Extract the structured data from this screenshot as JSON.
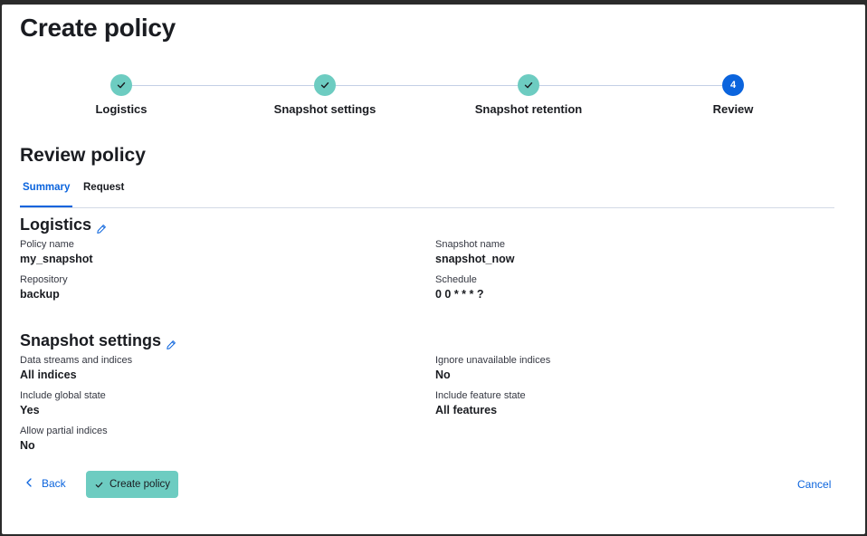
{
  "page": {
    "title": "Create policy"
  },
  "stepper": {
    "steps": [
      {
        "label": "Logistics",
        "status": "complete",
        "marker": ""
      },
      {
        "label": "Snapshot settings",
        "status": "complete",
        "marker": ""
      },
      {
        "label": "Snapshot retention",
        "status": "complete",
        "marker": ""
      },
      {
        "label": "Review",
        "status": "current",
        "marker": "4"
      }
    ]
  },
  "review": {
    "title": "Review policy",
    "tabs": [
      {
        "label": "Summary",
        "active": true
      },
      {
        "label": "Request",
        "active": false
      }
    ]
  },
  "logistics": {
    "title": "Logistics",
    "fields": {
      "policy_name": {
        "label": "Policy name",
        "value": "my_snapshot"
      },
      "snapshot_name": {
        "label": "Snapshot name",
        "value": "snapshot_now"
      },
      "repository": {
        "label": "Repository",
        "value": "backup"
      },
      "schedule": {
        "label": "Schedule",
        "value": "0 0 * * * ?"
      }
    }
  },
  "settings": {
    "title": "Snapshot settings",
    "fields": {
      "data_streams": {
        "label": "Data streams and indices",
        "value": "All indices"
      },
      "ignore_unavailable": {
        "label": "Ignore unavailable indices",
        "value": "No"
      },
      "global_state": {
        "label": "Include global state",
        "value": "Yes"
      },
      "feature_state": {
        "label": "Include feature state",
        "value": "All features"
      },
      "partial_indices": {
        "label": "Allow partial indices",
        "value": "No"
      }
    }
  },
  "footer": {
    "back_label": "Back",
    "create_label": "Create policy",
    "cancel_label": "Cancel"
  },
  "colors": {
    "accent": "#0b64dd",
    "success": "#6dccc1",
    "text": "#1a1c21"
  },
  "icons": {
    "complete_step": "check-icon",
    "edit": "pencil-icon",
    "back": "chevron-left-icon",
    "create": "check-icon"
  }
}
